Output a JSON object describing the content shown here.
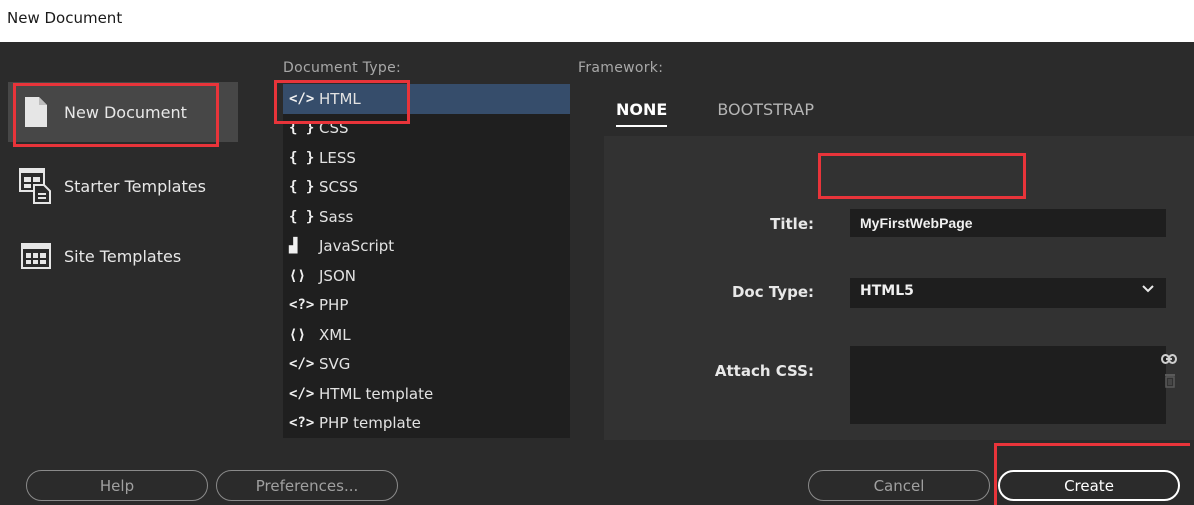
{
  "window": {
    "title": "New Document"
  },
  "categories": [
    {
      "label": "New Document",
      "icon": "new-document-icon",
      "selected": true
    },
    {
      "label": "Starter Templates",
      "icon": "starter-templates-icon",
      "selected": false
    },
    {
      "label": "Site Templates",
      "icon": "site-templates-icon",
      "selected": false
    }
  ],
  "document_type": {
    "label": "Document Type:",
    "items": [
      {
        "glyph": "</>",
        "label": "HTML",
        "selected": true
      },
      {
        "glyph": "{ }",
        "label": "CSS"
      },
      {
        "glyph": "{ }",
        "label": "LESS"
      },
      {
        "glyph": "{ }",
        "label": "SCSS"
      },
      {
        "glyph": "{ }",
        "label": "Sass"
      },
      {
        "glyph": "▟",
        "label": "JavaScript"
      },
      {
        "glyph": "⟨⟩",
        "label": "JSON"
      },
      {
        "glyph": "<?>",
        "label": "PHP"
      },
      {
        "glyph": "⟨⟩",
        "label": "XML"
      },
      {
        "glyph": "</>",
        "label": "SVG"
      },
      {
        "glyph": "</>",
        "label": "HTML template"
      },
      {
        "glyph": "<?>",
        "label": "PHP template"
      }
    ]
  },
  "framework": {
    "label": "Framework:",
    "tabs": [
      {
        "label": "NONE",
        "active": true
      },
      {
        "label": "BOOTSTRAP",
        "active": false
      }
    ],
    "title_label": "Title:",
    "title_value": "MyFirstWebPage",
    "doctype_label": "Doc Type:",
    "doctype_value": "HTML5",
    "attach_css_label": "Attach CSS:"
  },
  "buttons": {
    "help": "Help",
    "preferences": "Preferences...",
    "cancel": "Cancel",
    "create": "Create"
  },
  "colors": {
    "dialog_bg": "#2b2b2b",
    "list_bg": "#1f1f1f",
    "selection": "#364d6b",
    "highlight": "#e8343a"
  }
}
